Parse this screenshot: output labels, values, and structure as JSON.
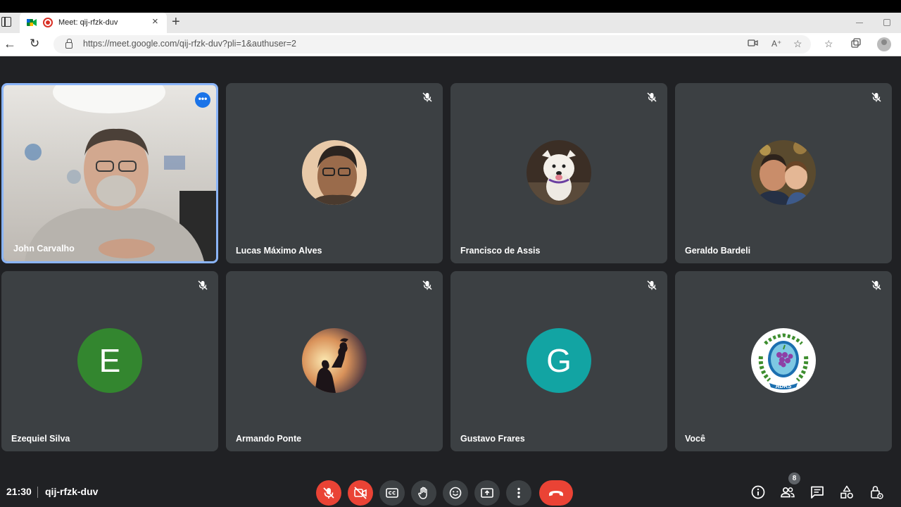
{
  "browser": {
    "tab_title": "Meet: qij-rfzk-duv",
    "tab_close": "×",
    "new_tab": "+",
    "url": "https://meet.google.com/qij-rfzk-duv?pli=1&authuser=2"
  },
  "participants": [
    {
      "name": "John Carvalho",
      "type": "video",
      "active": true
    },
    {
      "name": "Lucas Máximo Alves",
      "type": "photo",
      "muted": true
    },
    {
      "name": "Francisco de Assis",
      "type": "photo",
      "muted": true
    },
    {
      "name": "Geraldo Bardeli",
      "type": "photo",
      "muted": true
    },
    {
      "name": "Ezequiel Silva",
      "type": "letter",
      "letter": "E",
      "color": "#33862f",
      "muted": true
    },
    {
      "name": "Armando Ponte",
      "type": "photo",
      "muted": true
    },
    {
      "name": "Gustavo Frares",
      "type": "letter",
      "letter": "G",
      "color": "#12a4a3",
      "muted": true
    },
    {
      "name": "Você",
      "type": "logo",
      "logo_text": "ADRS",
      "muted": true
    }
  ],
  "bottom_bar": {
    "time": "21:30",
    "meeting_code": "qij-rfzk-duv",
    "participant_count": "8"
  },
  "colors": {
    "background": "#202124",
    "tile": "#3c4043",
    "active_border": "#8ab4f8",
    "danger": "#ea4335"
  }
}
